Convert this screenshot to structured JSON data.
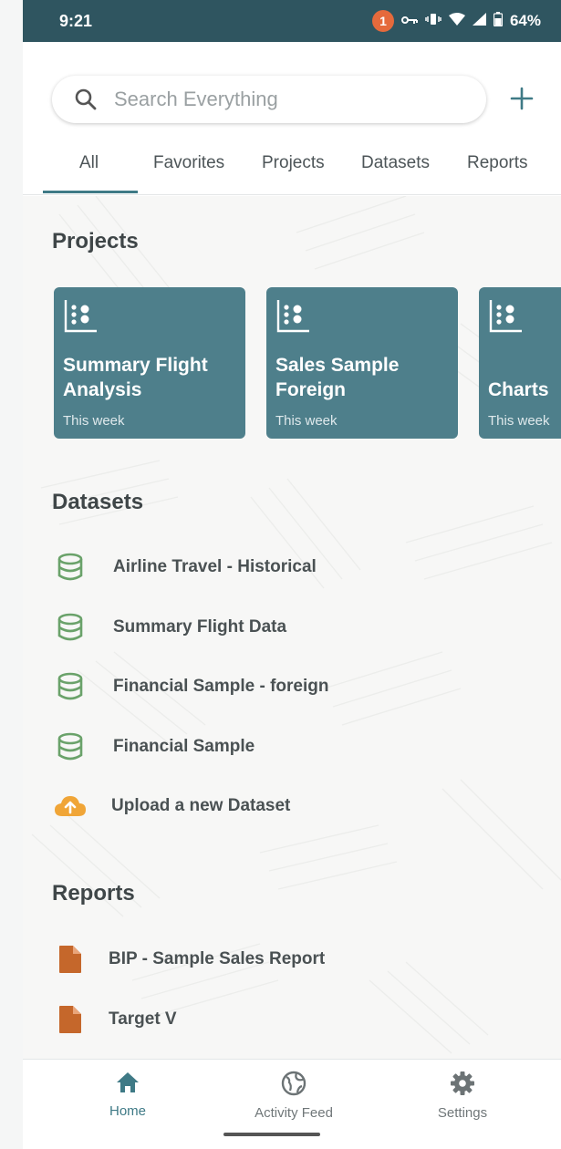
{
  "status_bar": {
    "time": "9:21",
    "notification_count": "1",
    "battery": "64%"
  },
  "search": {
    "placeholder": "Search Everything"
  },
  "tabs": [
    {
      "label": "All",
      "active": true
    },
    {
      "label": "Favorites"
    },
    {
      "label": "Projects"
    },
    {
      "label": "Datasets"
    },
    {
      "label": "Reports"
    }
  ],
  "projects": {
    "title": "Projects",
    "items": [
      {
        "title": "Summary Flight Analysis",
        "subtitle": "This week"
      },
      {
        "title": "Sales Sample Foreign",
        "subtitle": "This week"
      },
      {
        "title": "Charts",
        "subtitle": "This week"
      }
    ]
  },
  "datasets": {
    "title": "Datasets",
    "items": [
      {
        "label": "Airline Travel - Historical",
        "icon": "database-icon"
      },
      {
        "label": "Summary Flight Data",
        "icon": "database-icon"
      },
      {
        "label": "Financial Sample - foreign",
        "icon": "database-icon"
      },
      {
        "label": "Financial Sample",
        "icon": "database-icon"
      }
    ],
    "upload_label": "Upload a new Dataset"
  },
  "reports": {
    "title": "Reports",
    "items": [
      {
        "label": "BIP - Sample Sales Report",
        "icon": "report-file-icon"
      },
      {
        "label": "Target V",
        "icon": "report-file-icon"
      }
    ]
  },
  "bottom_nav": [
    {
      "label": "Home",
      "icon": "home-icon",
      "active": true
    },
    {
      "label": "Activity Feed",
      "icon": "globe-icon"
    },
    {
      "label": "Settings",
      "icon": "gear-icon"
    }
  ],
  "colors": {
    "status_bar": "#2f5560",
    "card": "#4e7f8b",
    "accent": "#3f7a86",
    "dataset_icon": "#6aa26a",
    "upload_icon": "#f0a537",
    "report_icon": "#c5672b"
  }
}
